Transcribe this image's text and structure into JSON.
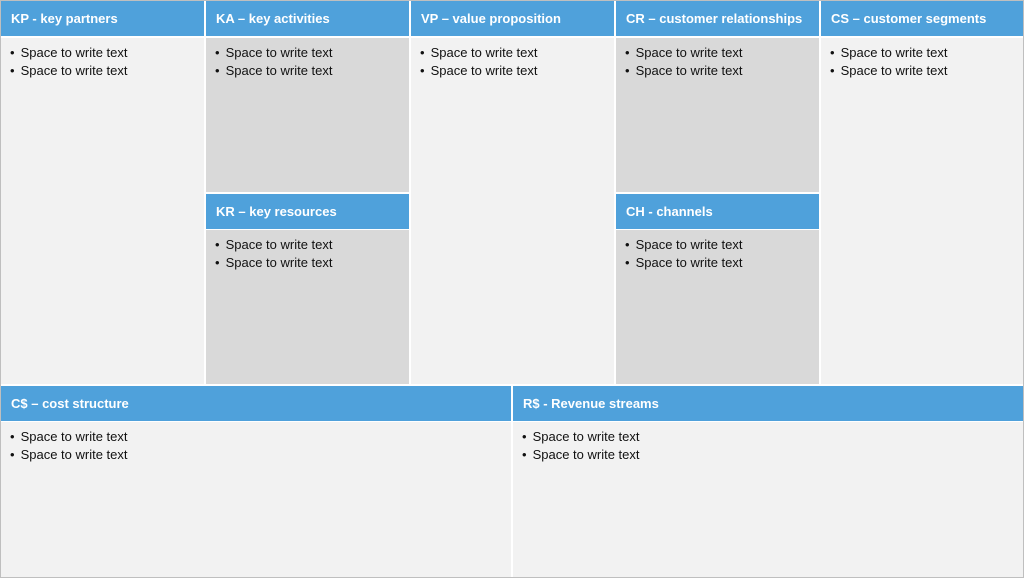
{
  "blocks": {
    "kp": {
      "title": "KP - key partners",
      "items": [
        "Space to write text",
        "Space to write text"
      ]
    },
    "ka": {
      "title": "KA – key activities",
      "items": [
        "Space to write text",
        "Space to write text"
      ]
    },
    "kr": {
      "title": "KR – key resources",
      "items": [
        "Space to write text",
        "Space to write text"
      ]
    },
    "vp": {
      "title": "VP – value proposition",
      "items": [
        "Space to write text",
        "Space to write text"
      ]
    },
    "cr": {
      "title": "CR – customer relationships",
      "items": [
        "Space to write text",
        "Space to write text"
      ]
    },
    "ch": {
      "title": "CH - channels",
      "items": [
        "Space to write text",
        "Space to write text"
      ]
    },
    "cs": {
      "title": "CS – customer segments",
      "items": [
        "Space to write text",
        "Space to write text"
      ]
    },
    "cost": {
      "title": "C$ – cost structure",
      "items": [
        "Space to write text",
        "Space to write text"
      ]
    },
    "rev": {
      "title": "R$ - Revenue streams",
      "items": [
        "Space to write text",
        "Space to write text"
      ]
    }
  },
  "colors": {
    "header": "#4fa1db",
    "light_panel": "#f2f2f2",
    "gray_panel": "#d9d9d9"
  }
}
